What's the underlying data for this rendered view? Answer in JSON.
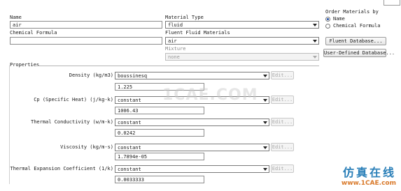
{
  "left": {
    "name_label": "Name",
    "name_value": "air",
    "chemical_formula_label": "Chemical Formula",
    "chemical_formula_value": ""
  },
  "middle": {
    "material_type_label": "Material Type",
    "material_type_value": "fluid",
    "fluent_fluid_materials_label": "Fluent Fluid Materials",
    "fluent_fluid_materials_value": "air",
    "mixture_label": "Mixture",
    "mixture_value": "none"
  },
  "order": {
    "title": "Order Materials by",
    "options": [
      "Name",
      "Chemical Formula"
    ],
    "selected": "Name"
  },
  "buttons": {
    "fluent_database": "Fluent Database...",
    "user_defined_database": "User-Defined Database..."
  },
  "properties": {
    "header": "Properties",
    "edit_label": "Edit...",
    "rows": [
      {
        "label": "Density (kg/m3)",
        "method": "boussinesq",
        "value": "1.225"
      },
      {
        "label": "Cp (Specific Heat) (j/kg-k)",
        "method": "constant",
        "value": "1006.43"
      },
      {
        "label": "Thermal Conductivity (w/m-k)",
        "method": "constant",
        "value": "0.0242"
      },
      {
        "label": "Viscosity (kg/m-s)",
        "method": "constant",
        "value": "1.7894e-05"
      },
      {
        "label": "Thermal Expansion Coefficient (1/k)",
        "method": "constant",
        "value": "0.0033333"
      }
    ]
  },
  "watermark": {
    "center": "1CAE.COM",
    "brand_cn": "仿真在线",
    "brand_url": "www.1CAE.com"
  },
  "colors": {
    "radio_dot": "#1f4fa8",
    "brand_blue": "#2a7fb8",
    "brand_orange": "#d9792a"
  }
}
